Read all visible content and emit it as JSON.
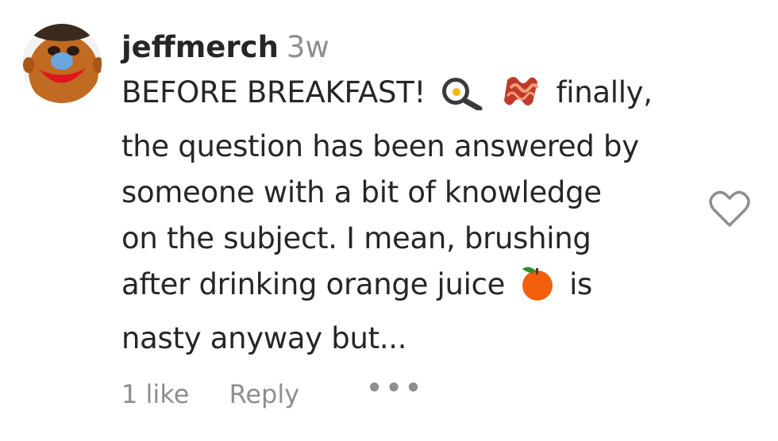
{
  "comment": {
    "username": "jeffmerch",
    "time": "3w",
    "lines": [
      [
        "BEFORE BREAKFAST!",
        "finally,"
      ],
      "the question has been answered by",
      "someone with a bit of knowledge",
      "on the subject. I mean, brushing",
      [
        "after drinking orange juice",
        "is"
      ],
      "nasty anyway but..."
    ],
    "emojis": [
      "frying-pan-egg-icon",
      "bacon-icon",
      "orange-icon"
    ],
    "likes_label": "1 like",
    "reply_label": "Reply",
    "more_label": "•••"
  },
  "colors": {
    "text": "#262626",
    "muted": "#8e8e8e",
    "heart_outline": "#8e8e8e"
  }
}
